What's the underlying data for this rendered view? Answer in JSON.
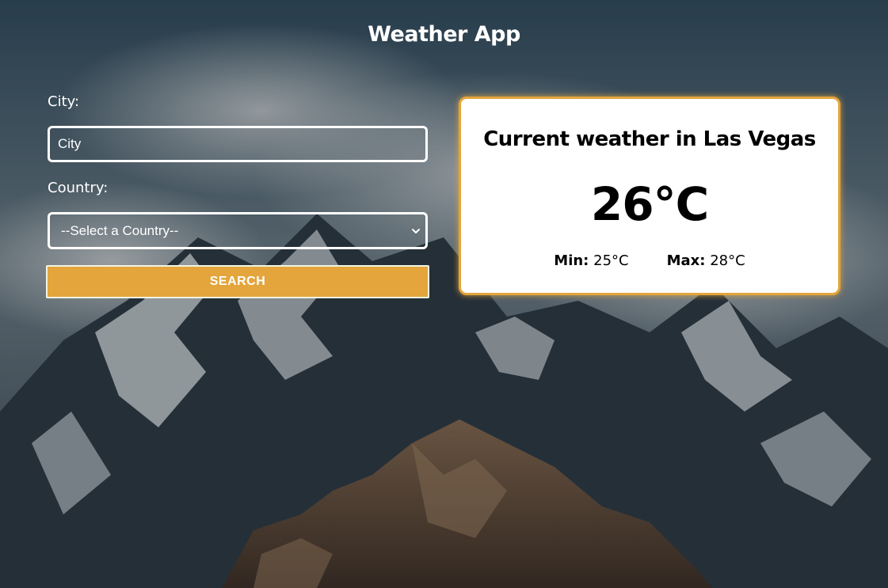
{
  "header": {
    "title": "Weather App"
  },
  "form": {
    "city_label": "City:",
    "city_placeholder": "City",
    "city_value": "",
    "country_label": "Country:",
    "country_selected": "--Select a Country--",
    "search_label": "SEARCH"
  },
  "weather": {
    "heading": "Current weather in Las Vegas",
    "temperature": "26°C",
    "min_label": "Min:",
    "min_value": "25°C",
    "max_label": "Max:",
    "max_value": "28°C"
  },
  "colors": {
    "accent": "#e3a53c",
    "card_background": "#ffffff",
    "text_on_background": "#ffffff"
  },
  "icons": {
    "select_arrow": "chevron-down-icon"
  }
}
